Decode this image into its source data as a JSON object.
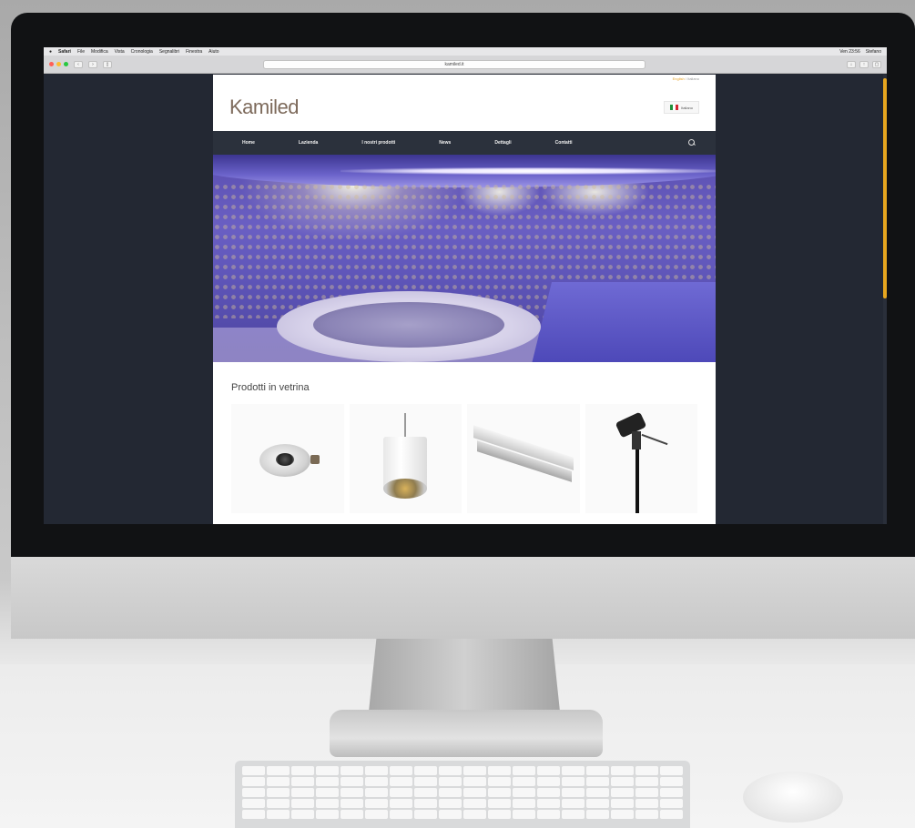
{
  "mac_menubar": {
    "items": [
      "Safari",
      "File",
      "Modifica",
      "Vista",
      "Cronologia",
      "Segnalibri",
      "Finestra",
      "Aiuto"
    ],
    "right_items": [
      "Ven 23:56",
      "Stefano"
    ]
  },
  "browser": {
    "url": "kamiled.it"
  },
  "site": {
    "topbar": {
      "language_links": [
        "English",
        "Italiano"
      ]
    },
    "logo": "Kamiled",
    "language_button": "Italiano",
    "nav": [
      "Home",
      "Lazienda",
      "I nostri prodotti",
      "News",
      "Dettagli",
      "Contatti"
    ],
    "showcase_title": "Prodotti in vetrina",
    "products": [
      {
        "name": "downlight",
        "icon": "downlight-product"
      },
      {
        "name": "pendant",
        "icon": "pendant-product"
      },
      {
        "name": "profile",
        "icon": "aluminium-profile-product"
      },
      {
        "name": "spot",
        "icon": "garden-spot-product"
      }
    ]
  },
  "colors": {
    "accent": "#e7a61f",
    "nav_bg": "#2b313c",
    "screen_bg": "#232833",
    "logo": "#7d6a5b"
  }
}
